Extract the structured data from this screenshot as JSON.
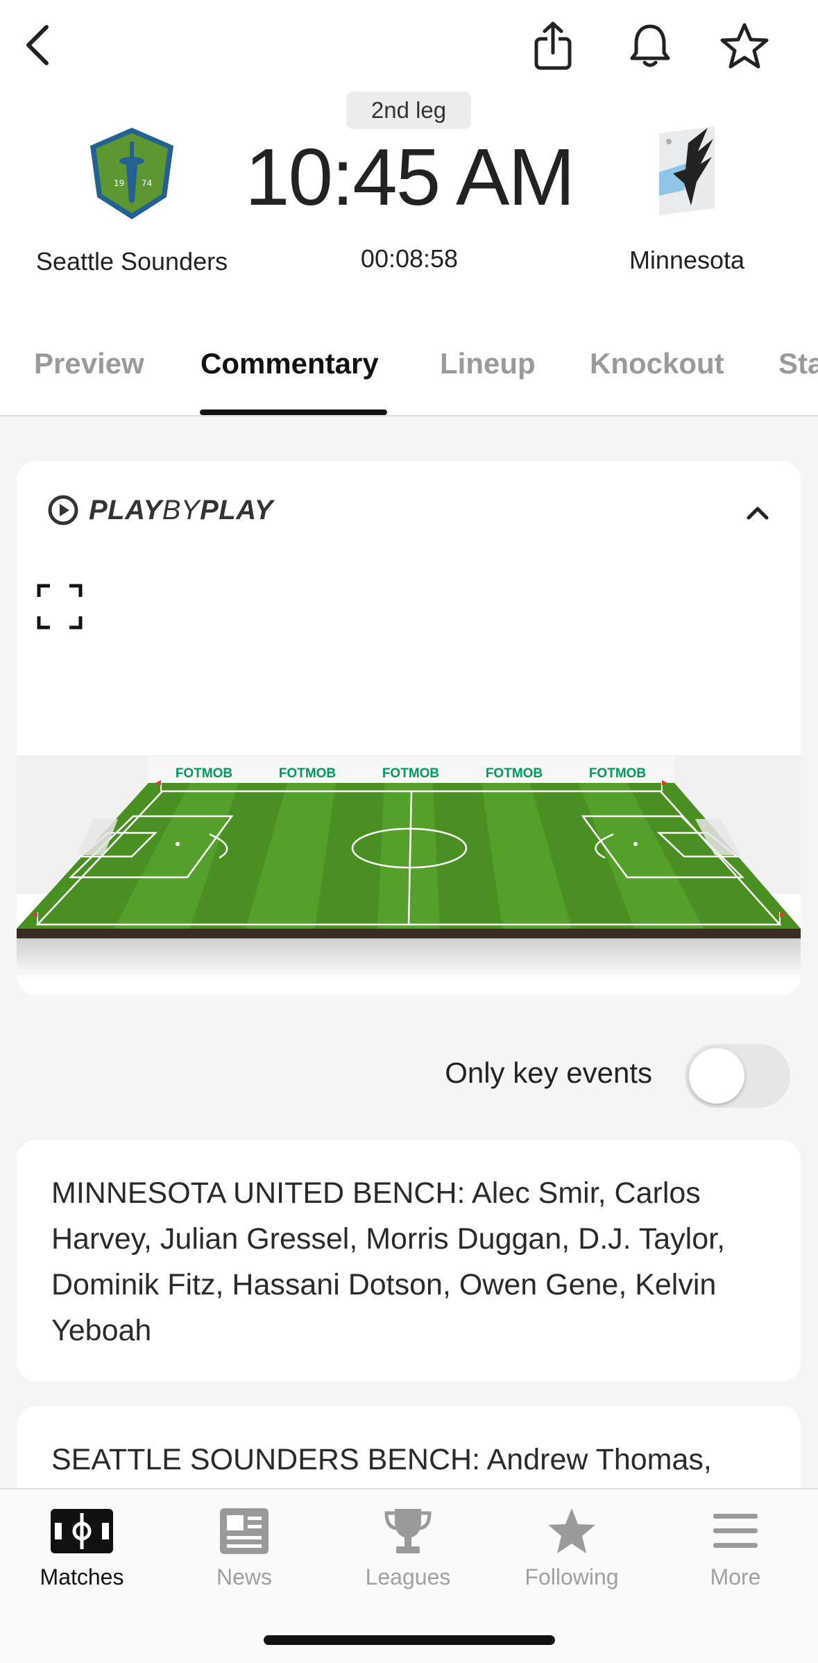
{
  "header": {
    "leg_badge": "2nd leg",
    "kickoff_time": "10:45 AM",
    "match_clock": "00:08:58",
    "home_team": {
      "name": "Seattle Sounders"
    },
    "away_team": {
      "name": "Minnesota"
    }
  },
  "tabs": [
    {
      "label": "Preview",
      "active": false
    },
    {
      "label": "Commentary",
      "active": true
    },
    {
      "label": "Lineup",
      "active": false
    },
    {
      "label": "Knockout",
      "active": false
    },
    {
      "label": "Sta",
      "active": false
    }
  ],
  "play_by_play": {
    "brand_bold_1": "PLAY",
    "brand_thin": "BY",
    "brand_bold_2": "PLAY",
    "board_text": "FOTMOB"
  },
  "filter": {
    "only_key_events_label": "Only key events",
    "only_key_events_on": false
  },
  "commentary": [
    {
      "text": "MINNESOTA UNITED BENCH: Alec Smir, Carlos Harvey, Julian Gressel, Morris Duggan, D.J. Taylor, Dominik Fitz, Hassani Dotson, Owen Gene, Kelvin Yeboah"
    },
    {
      "text": "SEATTLE SOUNDERS BENCH: Andrew Thomas,"
    }
  ],
  "bottom_nav": [
    {
      "label": "Matches",
      "icon": "pitch-icon",
      "active": true
    },
    {
      "label": "News",
      "icon": "newspaper-icon",
      "active": false
    },
    {
      "label": "Leagues",
      "icon": "trophy-icon",
      "active": false
    },
    {
      "label": "Following",
      "icon": "star-icon",
      "active": false
    },
    {
      "label": "More",
      "icon": "menu-icon",
      "active": false
    }
  ],
  "colors": {
    "sounders_green": "#5d9732",
    "sounders_blue": "#236192",
    "pitch_green": "#4a8f22",
    "fotmob_green": "#00985f",
    "inactive_gray": "#9a9a9a"
  }
}
